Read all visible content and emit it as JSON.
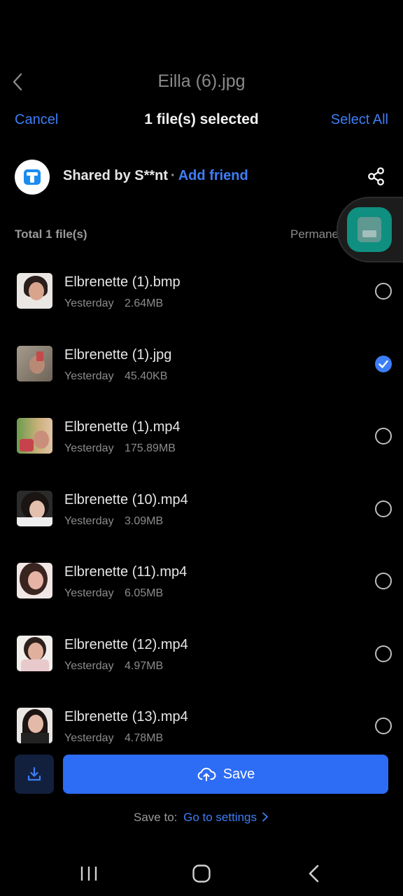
{
  "header": {
    "title": "Eilla (6).jpg",
    "cancel_label": "Cancel",
    "selection_status": "1 file(s) selected",
    "select_all_label": "Select All"
  },
  "share": {
    "shared_by": "Shared by S**nt",
    "separator": "·",
    "add_friend_label": "Add friend"
  },
  "summary": {
    "total": "Total 1 file(s)",
    "validity": "Permanent validity"
  },
  "files": [
    {
      "name": "Elbrenette (1).bmp",
      "date": "Yesterday",
      "size": "2.64MB",
      "selected": false
    },
    {
      "name": "Elbrenette (1).jpg",
      "date": "Yesterday",
      "size": "45.40KB",
      "selected": true
    },
    {
      "name": "Elbrenette (1).mp4",
      "date": "Yesterday",
      "size": "175.89MB",
      "selected": false
    },
    {
      "name": "Elbrenette (10).mp4",
      "date": "Yesterday",
      "size": "3.09MB",
      "selected": false
    },
    {
      "name": "Elbrenette (11).mp4",
      "date": "Yesterday",
      "size": "6.05MB",
      "selected": false
    },
    {
      "name": "Elbrenette (12).mp4",
      "date": "Yesterday",
      "size": "4.97MB",
      "selected": false
    },
    {
      "name": "Elbrenette (13).mp4",
      "date": "Yesterday",
      "size": "4.78MB",
      "selected": false
    }
  ],
  "actions": {
    "save_label": "Save",
    "save_to_label": "Save to:",
    "settings_link": "Go to settings"
  },
  "icons": {
    "back": "back-chevron-icon",
    "brand": "terabox-logo-icon",
    "share": "share-icon",
    "download": "download-icon",
    "cloud_upload": "cloud-upload-icon",
    "checkmark": "checkmark-icon"
  },
  "colors": {
    "accent": "#3d7ef7",
    "save_button": "#2d6cf5",
    "background": "#000000"
  }
}
